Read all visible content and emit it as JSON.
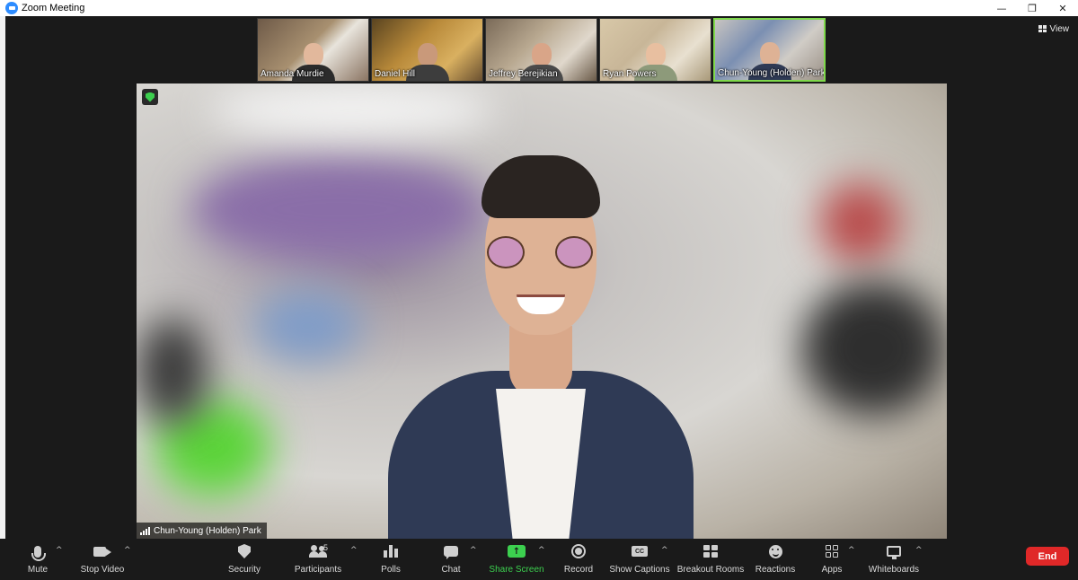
{
  "window": {
    "title": "Zoom Meeting",
    "controls": {
      "minimize": "—",
      "restore": "❐",
      "close": "✕"
    }
  },
  "view_button": {
    "label": "View"
  },
  "thumbnails": [
    {
      "name": "Amanda Murdie",
      "bg": "#8a7462",
      "shirt": "#2b2b2b",
      "active": false
    },
    {
      "name": "Daniel Hill",
      "bg": "#b98a3a",
      "shirt": "#3d3d3d",
      "active": false
    },
    {
      "name": "Jeffrey Berejikian",
      "bg": "#9a8c7a",
      "shirt": "#4a4a4a",
      "active": false
    },
    {
      "name": "Ryan Powers",
      "bg": "#c8b698",
      "shirt": "#8d9a7a",
      "active": false
    },
    {
      "name": "Chun-Young (Holden) Park",
      "bg": "#7b8fb2",
      "shirt": "#2f3a55",
      "active": true
    }
  ],
  "active_speaker": {
    "name": "Chun-Young (Holden) Park"
  },
  "toolbar": {
    "mute": "Mute",
    "stop_video": "Stop Video",
    "security": "Security",
    "participants": "Participants",
    "participant_count": "5",
    "polls": "Polls",
    "chat": "Chat",
    "share_screen": "Share Screen",
    "record": "Record",
    "show_captions": "Show Captions",
    "captions_icon_text": "CC",
    "breakout_rooms": "Breakout Rooms",
    "reactions": "Reactions",
    "apps": "Apps",
    "whiteboards": "Whiteboards",
    "end": "End",
    "caret": "^",
    "share_arrow": "↑"
  },
  "colors": {
    "accent_green": "#3cd04f",
    "end_red": "#e02828",
    "toolbar_bg": "#1a1a1a"
  }
}
